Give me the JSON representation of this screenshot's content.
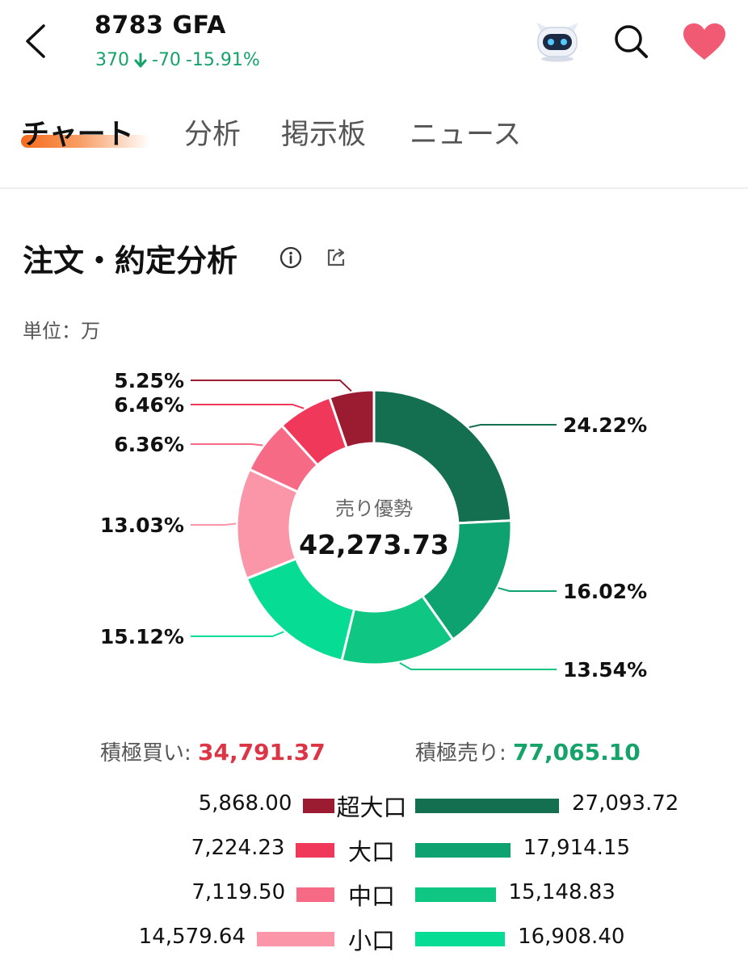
{
  "header": {
    "title": "8783  GFA",
    "price": "370",
    "change": "-70",
    "change_pct": "-15.91%"
  },
  "tabs": [
    {
      "label": "チャート"
    },
    {
      "label": "分析"
    },
    {
      "label": "掲示板"
    },
    {
      "label": "ニュース"
    }
  ],
  "section": {
    "title": "注文・約定分析",
    "unit": "単位：万"
  },
  "colors": {
    "buy_super": "#9b1b30",
    "buy_large": "#f0395a",
    "buy_mid": "#f66a85",
    "buy_small": "#fb96a8",
    "sell_super": "#136f50",
    "sell_large": "#0ea271",
    "sell_mid": "#0fc783",
    "sell_small": "#06dc93",
    "price_green": "#16a36a",
    "accent_red": "#dc3545"
  },
  "chart_data": {
    "type": "pie",
    "center_label": "売り優勢",
    "center_value": "42,273.73",
    "slices": [
      {
        "label": "24.22%",
        "value": 24.22,
        "color": "#136f50"
      },
      {
        "label": "16.02%",
        "value": 16.02,
        "color": "#0ea271"
      },
      {
        "label": "13.54%",
        "value": 13.54,
        "color": "#0fc783"
      },
      {
        "label": "15.12%",
        "value": 15.12,
        "color": "#06dc93"
      },
      {
        "label": "13.03%",
        "value": 13.03,
        "color": "#fb96a8"
      },
      {
        "label": "6.36%",
        "value": 6.36,
        "color": "#f66a85"
      },
      {
        "label": "6.46%",
        "value": 6.46,
        "color": "#f0395a"
      },
      {
        "label": "5.25%",
        "value": 5.25,
        "color": "#9b1b30"
      }
    ]
  },
  "totals": {
    "buy_label": "積極買い:",
    "buy_value": "34,791.37",
    "sell_label": "積極売り:",
    "sell_value": "77,065.10"
  },
  "breakdown": [
    {
      "label": "超大口",
      "buy": "5,868.00",
      "sell": "27,093.72",
      "buy_num": 5868.0,
      "sell_num": 27093.72
    },
    {
      "label": "大口",
      "buy": "7,224.23",
      "sell": "17,914.15",
      "buy_num": 7224.23,
      "sell_num": 17914.15
    },
    {
      "label": "中口",
      "buy": "7,119.50",
      "sell": "15,148.83",
      "buy_num": 7119.5,
      "sell_num": 15148.83
    },
    {
      "label": "小口",
      "buy": "14,579.64",
      "sell": "16,908.40",
      "buy_num": 14579.64,
      "sell_num": 16908.4
    }
  ]
}
